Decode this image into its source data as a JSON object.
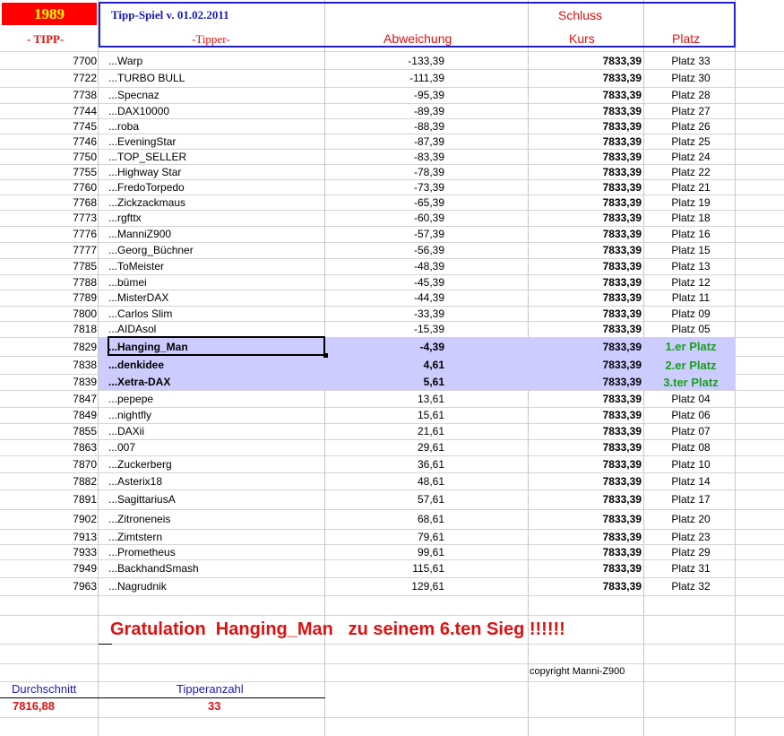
{
  "header": {
    "year": "1989",
    "title": "Tipp-Spiel v. 01.02.2011",
    "schluss": "Schluss",
    "col_tipp": "- TIPP-",
    "col_tipper": "-Tipper-",
    "col_abweichung": "Abweichung",
    "col_kurs": "Kurs",
    "col_platz": "Platz"
  },
  "rows": [
    {
      "tipp": "7700",
      "name": "...Warp",
      "abw": "-133,39",
      "kurs": "7833,39",
      "platz": "Platz 33"
    },
    {
      "tipp": "7722",
      "name": "...TURBO BULL",
      "abw": "-111,39",
      "kurs": "7833,39",
      "platz": "Platz 30"
    },
    {
      "tipp": "7738",
      "name": "...Specnaz",
      "abw": "-95,39",
      "kurs": "7833,39",
      "platz": "Platz 28"
    },
    {
      "tipp": "7744",
      "name": "...DAX10000",
      "abw": "-89,39",
      "kurs": "7833,39",
      "platz": "Platz 27"
    },
    {
      "tipp": "7745",
      "name": "...roba",
      "abw": "-88,39",
      "kurs": "7833,39",
      "platz": "Platz 26"
    },
    {
      "tipp": "7746",
      "name": "...EveningStar",
      "abw": "-87,39",
      "kurs": "7833,39",
      "platz": "Platz 25"
    },
    {
      "tipp": "7750",
      "name": "...TOP_SELLER",
      "abw": "-83,39",
      "kurs": "7833,39",
      "platz": "Platz 24"
    },
    {
      "tipp": "7755",
      "name": "...Highway Star",
      "abw": "-78,39",
      "kurs": "7833,39",
      "platz": "Platz 22"
    },
    {
      "tipp": "7760",
      "name": "...FredoTorpedo",
      "abw": "-73,39",
      "kurs": "7833,39",
      "platz": "Platz 21"
    },
    {
      "tipp": "7768",
      "name": "...Zickzackmaus",
      "abw": "-65,39",
      "kurs": "7833,39",
      "platz": "Platz 19"
    },
    {
      "tipp": "7773",
      "name": "...rgfttx",
      "abw": "-60,39",
      "kurs": "7833,39",
      "platz": "Platz 18"
    },
    {
      "tipp": "7776",
      "name": "...ManniZ900",
      "abw": "-57,39",
      "kurs": "7833,39",
      "platz": "Platz 16"
    },
    {
      "tipp": "7777",
      "name": "...Georg_Büchner",
      "abw": "-56,39",
      "kurs": "7833,39",
      "platz": "Platz 15"
    },
    {
      "tipp": "7785",
      "name": "...ToMeister",
      "abw": "-48,39",
      "kurs": "7833,39",
      "platz": "Platz 13"
    },
    {
      "tipp": "7788",
      "name": "...bümei",
      "abw": "-45,39",
      "kurs": "7833,39",
      "platz": "Platz 12"
    },
    {
      "tipp": "7789",
      "name": "...MisterDAX",
      "abw": "-44,39",
      "kurs": "7833,39",
      "platz": "Platz 11"
    },
    {
      "tipp": "7800",
      "name": "...Carlos Slim",
      "abw": "-33,39",
      "kurs": "7833,39",
      "platz": "Platz 09"
    },
    {
      "tipp": "7818",
      "name": "...AIDAsol",
      "abw": "-15,39",
      "kurs": "7833,39",
      "platz": "Platz 05"
    },
    {
      "tipp": "7829",
      "name": "...Hanging_Man",
      "abw": "-4,39",
      "kurs": "7833,39",
      "platz": "1.er Platz"
    },
    {
      "tipp": "7838",
      "name": "...denkidee",
      "abw": "4,61",
      "kurs": "7833,39",
      "platz": "2.er Platz"
    },
    {
      "tipp": "7839",
      "name": "...Xetra-DAX",
      "abw": "5,61",
      "kurs": "7833,39",
      "platz": "3.ter Platz"
    },
    {
      "tipp": "7847",
      "name": "...pepepe",
      "abw": "13,61",
      "kurs": "7833,39",
      "platz": "Platz 04"
    },
    {
      "tipp": "7849",
      "name": "...nightfly",
      "abw": "15,61",
      "kurs": "7833,39",
      "platz": "Platz 06"
    },
    {
      "tipp": "7855",
      "name": "...DAXii",
      "abw": "21,61",
      "kurs": "7833,39",
      "platz": "Platz 07"
    },
    {
      "tipp": "7863",
      "name": "...007",
      "abw": "29,61",
      "kurs": "7833,39",
      "platz": "Platz 08"
    },
    {
      "tipp": "7870",
      "name": "...Zuckerberg",
      "abw": "36,61",
      "kurs": "7833,39",
      "platz": "Platz 10"
    },
    {
      "tipp": "7882",
      "name": "...Asterix18",
      "abw": "48,61",
      "kurs": "7833,39",
      "platz": "Platz 14"
    },
    {
      "tipp": "7891",
      "name": "...SagittariusA",
      "abw": "57,61",
      "kurs": "7833,39",
      "platz": "Platz 17"
    },
    {
      "tipp": "7902",
      "name": "...Zitroneneis",
      "abw": "68,61",
      "kurs": "7833,39",
      "platz": "Platz 20"
    },
    {
      "tipp": "7913",
      "name": "...Zimtstern",
      "abw": "79,61",
      "kurs": "7833,39",
      "platz": "Platz 23"
    },
    {
      "tipp": "7933",
      "name": "...Prometheus",
      "abw": "99,61",
      "kurs": "7833,39",
      "platz": "Platz 29"
    },
    {
      "tipp": "7949",
      "name": "...BackhandSmash",
      "abw": "115,61",
      "kurs": "7833,39",
      "platz": "Platz 31"
    },
    {
      "tipp": "7963",
      "name": "...Nagrudnik",
      "abw": "129,61",
      "kurs": "7833,39",
      "platz": "Platz 32"
    }
  ],
  "footer": {
    "congrats": "Gratulation  Hanging_Man   zu seinem 6.ten Sieg !!!!!!",
    "copyright": "copyright Manni-Z900",
    "durchschnitt_label": "Durchschnitt",
    "tipperanzahl_label": "Tipperanzahl",
    "durchschnitt_value": "7816,88",
    "tipperanzahl_value": "33"
  },
  "colors": {
    "accent_red": "#e01010",
    "title_blue": "#1a1ab8",
    "podium_green": "#17a017",
    "highlight": "#ccccff",
    "year_bg": "#ff0000",
    "year_fg": "#ffff00"
  }
}
